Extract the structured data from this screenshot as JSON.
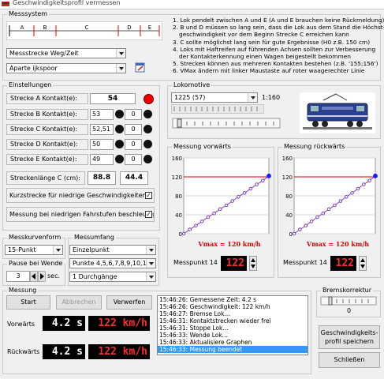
{
  "window": {
    "title": "Geschwindigkeitsprofil vermessen"
  },
  "messsystem": {
    "label": "Messsystem",
    "track_labels": [
      "A",
      "B",
      "C",
      "D",
      "E"
    ],
    "instructions": [
      "1. Lok pendelt zwischen A und E (A und E brauchen keine Rückmeldung)",
      "2. B und D müssen so lang sein, dass die Lok aus dem Stand die Höchst-",
      "   geschwindigkeit vor dem Beginn Strecke C erreichen kann",
      "3. C sollte möglichst lang sein für gute Ergebnisse (H0 z.B. 150 cm)",
      "4. Loks mit Haftreifen auf führenden Achsen sollten zur Verbesserung",
      "   der Kontakterkennung einen Wagen beigestellt bekommen",
      "5. Strecken können aus mehreren Kontakten bestehen (z.B. '155;156')",
      "6. VMax ändern mit linker Maustaste auf roter waagerechter Linie"
    ],
    "mode_select": "Messstrecke Weg/Zeit",
    "track_select": "Aparte ijkspoor"
  },
  "einstellungen": {
    "label": "Einstellungen",
    "rows": [
      {
        "label": "Strecke A Kontakt(e):",
        "v1": "54",
        "v2": "",
        "status": "red"
      },
      {
        "label": "Strecke B Kontakt(e):",
        "v1": "53",
        "v2": "0",
        "status": "black"
      },
      {
        "label": "Strecke C Kontakt(e):",
        "v1": "52,51",
        "v2": "0",
        "status": "black"
      },
      {
        "label": "Strecke D Kontakt(e):",
        "v1": "50",
        "v2": "0",
        "status": "black"
      },
      {
        "label": "Strecke E Kontakt(e):",
        "v1": "49",
        "v2": "0",
        "status": "black"
      }
    ],
    "length_label": "Streckenlänge C (cm):",
    "length_value": "88.8",
    "length_value2": "44.4",
    "kurzstrecke_label": "Kurzstrecke für niedrige Geschwindigkeiten:",
    "beschleunigen_label": "Messung bei niedrigen Fahrstufen beschleunigen:",
    "check_mark": "✓"
  },
  "messkurvenform": {
    "label": "Messkurvenform",
    "value": "15-Punkt"
  },
  "messumfang": {
    "label": "Messumfang",
    "mode": "Einzelpunkt",
    "points": "Punkte 4,5,6,7,8,9,10,11,12",
    "passes": "1 Durchgänge"
  },
  "pause": {
    "label": "Pause bei Wende",
    "value": "3",
    "unit": "sec."
  },
  "lokomotive": {
    "label": "Lokomotive",
    "loco": "1225 (57)",
    "scale": "1:160"
  },
  "vorwaerts_chart": {
    "label": "Messung vorwärts",
    "vmax_label": "Vmax = 120 km/h",
    "messpunkt_label": "Messpunkt 14",
    "messpunkt_value": "122"
  },
  "rueckwaerts_chart": {
    "label": "Messung rückwärts",
    "vmax_label": "Vmax = 120 km/h",
    "messpunkt_label": "Messpunkt 14",
    "messpunkt_value": "122"
  },
  "messung": {
    "label": "Messung",
    "start": "Start",
    "abbrechen": "Abbrechen",
    "verwerfen": "Verwerfen",
    "vorwaerts_label": "Vorwärts",
    "vorwaerts_time": "4.2 s",
    "vorwaerts_speed": "122 km/h",
    "rueckwaerts_label": "Rückwärts",
    "rueckwaerts_time": "4.2 s",
    "rueckwaerts_speed": "122 km/h"
  },
  "log": [
    "15:46:26: Gemessene Zeit: 4.2 s",
    "15:46:26: Geschwindigkeit: 122 km/h",
    "15:46:27: Bremse Lok...",
    "15:46:31: Kontaktstrecken wieder frei",
    "15:46:31: Stoppe Lok...",
    "15:46:33: Wende Lok...",
    "15:46:33: Aktualisiere Graphen",
    "15:46:33: Messung beendet"
  ],
  "bremskorrektur": {
    "label": "Bremskorrektur",
    "value": "0"
  },
  "buttons": {
    "save_profile": "Geschwindigkeits-\nprofil speichern",
    "close": "Schließen"
  },
  "chart_data": [
    {
      "type": "line",
      "title": "Messung vorwärts",
      "x": [
        0,
        1,
        2,
        3,
        4,
        5,
        6,
        7,
        8,
        9,
        10,
        11,
        12,
        13,
        14
      ],
      "y": [
        0,
        9,
        17,
        26,
        35,
        43,
        52,
        60,
        69,
        78,
        86,
        95,
        104,
        112,
        122
      ],
      "yticks": [
        0,
        40,
        80,
        120,
        160
      ],
      "ylim": [
        0,
        160
      ],
      "vmax": 120,
      "vmax_label": "Vmax = 120 km/h",
      "grid": true
    },
    {
      "type": "line",
      "title": "Messung rückwärts",
      "x": [
        0,
        1,
        2,
        3,
        4,
        5,
        6,
        7,
        8,
        9,
        10,
        11,
        12,
        13,
        14
      ],
      "y": [
        0,
        9,
        17,
        26,
        35,
        43,
        52,
        60,
        69,
        78,
        86,
        95,
        104,
        112,
        122
      ],
      "yticks": [
        0,
        40,
        80,
        120,
        160
      ],
      "ylim": [
        0,
        160
      ],
      "vmax": 120,
      "vmax_label": "Vmax = 120 km/h",
      "grid": true
    }
  ]
}
